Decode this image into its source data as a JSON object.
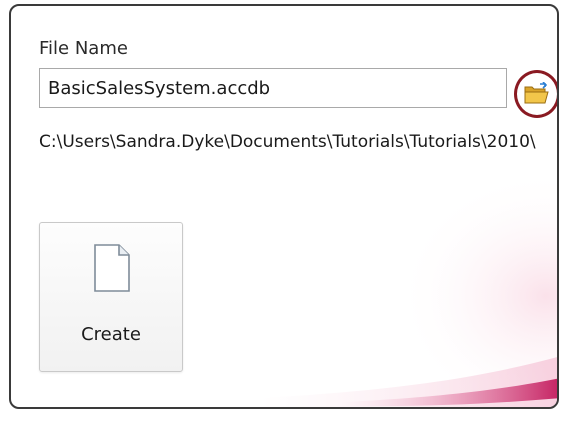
{
  "file_name": {
    "label": "File Name",
    "value": "BasicSalesSystem.accdb"
  },
  "save_path": "C:\\Users\\Sandra.Dyke\\Documents\\Tutorials\\Tutorials\\2010\\",
  "create_button": {
    "label": "Create"
  },
  "icons": {
    "browse": "folder-open-icon",
    "create": "blank-document-icon"
  },
  "colors": {
    "highlight_circle": "#8a1a22",
    "accent_swoosh": "#c2185b"
  }
}
